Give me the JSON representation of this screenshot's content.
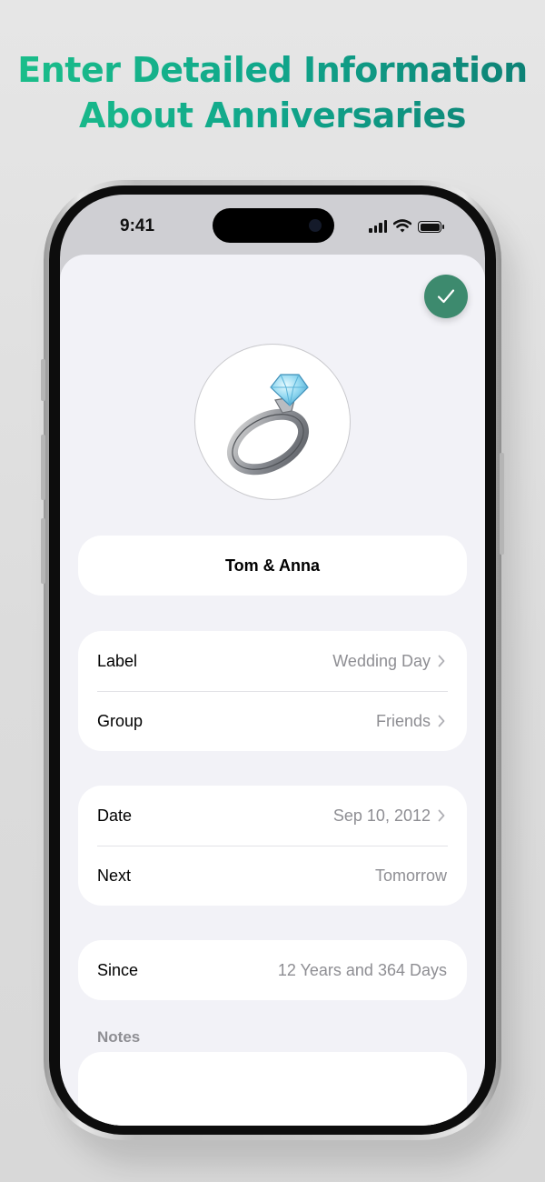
{
  "headline": {
    "line1": "Enter Detailed Information",
    "line2": "About Anniversaries"
  },
  "status_bar": {
    "time": "9:41"
  },
  "anniversary": {
    "name": "Tom & Anna",
    "icon": "diamond-ring-icon"
  },
  "details_group_1": [
    {
      "label": "Label",
      "value": "Wedding Day",
      "chevron": true
    },
    {
      "label": "Group",
      "value": "Friends",
      "chevron": true
    }
  ],
  "details_group_2": [
    {
      "label": "Date",
      "value": "Sep 10, 2012",
      "chevron": true
    },
    {
      "label": "Next",
      "value": "Tomorrow",
      "chevron": false
    }
  ],
  "since": {
    "label": "Since",
    "value": "12 Years and 364 Days"
  },
  "notes": {
    "title": "Notes",
    "value": ""
  },
  "colors": {
    "accent": "#3d8a6e",
    "headline_gradient_start": "#1bbf8a",
    "headline_gradient_end": "#0d7f74",
    "secondary_text": "#8e8e93",
    "background": "#f2f2f7"
  }
}
